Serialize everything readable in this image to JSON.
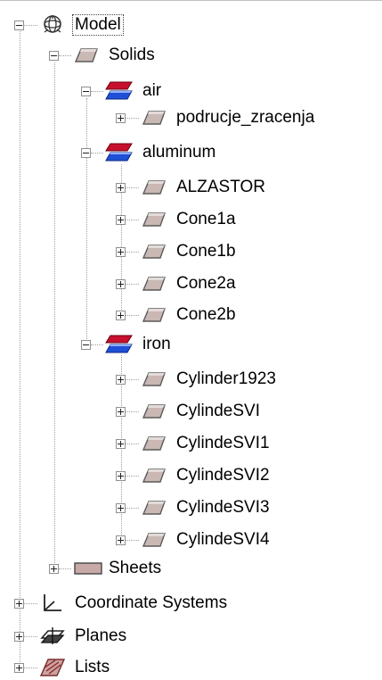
{
  "tree": {
    "root": {
      "label": "Model",
      "expanded": true,
      "icon": "model-icon"
    },
    "solids": {
      "label": "Solids",
      "expanded": true,
      "icon": "solid-icon"
    },
    "air": {
      "label": "air",
      "expanded": true,
      "icon": "material-icon",
      "children": [
        "podrucje_zracenja"
      ]
    },
    "aluminum": {
      "label": "aluminum",
      "expanded": true,
      "icon": "material-icon",
      "children": [
        "ALZASTOR",
        "Cone1a",
        "Cone1b",
        "Cone2a",
        "Cone2b"
      ]
    },
    "iron": {
      "label": "iron",
      "expanded": true,
      "icon": "material-icon",
      "children": [
        "Cylinder1923",
        "CylindeSVI",
        "CylindeSVI1",
        "CylindeSVI2",
        "CylindeSVI3",
        "CylindeSVI4"
      ]
    },
    "sheets": {
      "label": "Sheets",
      "expanded": false,
      "icon": "sheet-icon"
    },
    "coordinate_systems": {
      "label": "Coordinate Systems",
      "expanded": false,
      "icon": "coordinate-system-icon"
    },
    "planes": {
      "label": "Planes",
      "expanded": false,
      "icon": "plane-icon"
    },
    "lists": {
      "label": "Lists",
      "expanded": false,
      "icon": "list-icon"
    }
  },
  "colors": {
    "material_top": "#c8102e",
    "material_bottom": "#1f4fd6",
    "solid_fill": "#c9b8b4",
    "sheet_fill": "#c7aaa8"
  }
}
